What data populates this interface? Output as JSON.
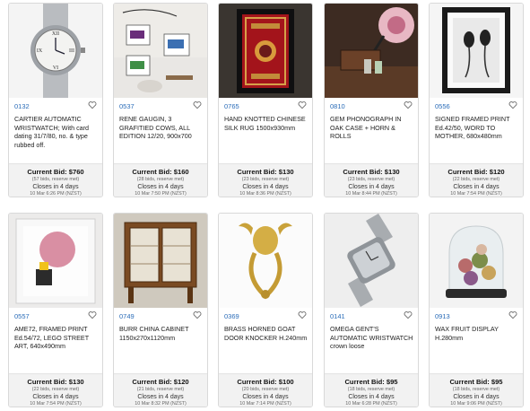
{
  "lots": [
    {
      "lot": "0132",
      "title": "CARTIER AUTOMATIC WRISTWATCH; With card dating 31/7/80, no. & type rubbed off.",
      "current_bid": "Current Bid: $760",
      "bids": "(57 bids, reserve met)",
      "closes": "Closes in 4 days",
      "date": "10 Mar 6:26 PM (NZST)",
      "image": "watch-photo"
    },
    {
      "lot": "0537",
      "title": "RENE GAUGIN, 3 GRAFITIED COWS, ALL EDITION 12/20, 900x700",
      "current_bid": "Current Bid: $160",
      "bids": "(28 bids, reserve met)",
      "closes": "Closes in 4 days",
      "date": "10 Mar 7:50 PM (NZST)",
      "image": "cow-prints-photo"
    },
    {
      "lot": "0765",
      "title": "HAND KNOTTED CHINESE SILK RUG 1500x930mm",
      "current_bid": "Current Bid: $130",
      "bids": "(23 bids, reserve met)",
      "closes": "Closes in 4 days",
      "date": "10 Mar 8:36 PM (NZST)",
      "image": "rug-photo"
    },
    {
      "lot": "0810",
      "title": "GEM PHONOGRAPH IN OAK CASE + HORN & ROLLS",
      "current_bid": "Current Bid: $130",
      "bids": "(23 bids, reserve met)",
      "closes": "Closes in 4 days",
      "date": "10 Mar 8:44 PM (NZST)",
      "image": "phonograph-photo"
    },
    {
      "lot": "0556",
      "title": "SIGNED FRAMED PRINT Ed.42/50, WORD TO MOTHER, 680x480mm",
      "current_bid": "Current Bid: $120",
      "bids": "(22 bids, reserve met)",
      "closes": "Closes in 4 days",
      "date": "10 Mar 7:54 PM (NZST)",
      "image": "framed-print-photo"
    },
    {
      "lot": "0557",
      "title": "AME72, FRAMED PRINT Ed.54/72, LEGO STREET ART, 640x490mm",
      "current_bid": "Current Bid: $130",
      "bids": "(22 bids, reserve met)",
      "closes": "Closes in 4 days",
      "date": "10 Mar 7:54 PM (NZST)",
      "image": "lego-print-photo"
    },
    {
      "lot": "0749",
      "title": "BURR CHINA CABINET 1150x270x1120mm",
      "current_bid": "Current Bid: $120",
      "bids": "(21 bids, reserve met)",
      "closes": "Closes in 4 days",
      "date": "10 Mar 8:32 PM (NZST)",
      "image": "cabinet-photo"
    },
    {
      "lot": "0369",
      "title": "BRASS HORNED GOAT DOOR KNOCKER H.240mm",
      "current_bid": "Current Bid: $100",
      "bids": "(20 bids, reserve met)",
      "closes": "Closes in 4 days",
      "date": "10 Mar 7:14 PM (NZST)",
      "image": "door-knocker-photo"
    },
    {
      "lot": "0141",
      "title": "OMEGA GENT'S AUTOMATIC WRISTWATCH crown loose",
      "current_bid": "Current Bid: $95",
      "bids": "(18 bids, reserve met)",
      "closes": "Closes in 4 days",
      "date": "10 Mar 6:28 PM (NZST)",
      "image": "omega-watch-photo"
    },
    {
      "lot": "0913",
      "title": "WAX FRUIT DISPLAY H.280mm",
      "current_bid": "Current Bid: $95",
      "bids": "(18 bids, reserve met)",
      "closes": "Closes in 4 days",
      "date": "10 Mar 9:06 PM (NZST)",
      "image": "wax-fruit-photo"
    }
  ],
  "colors": {
    "lot_number": "#2a6cb8",
    "bid_panel": "#f2f2f2",
    "border": "#d9d9d9"
  },
  "icons": {
    "favourite": "heart-outline-icon"
  }
}
